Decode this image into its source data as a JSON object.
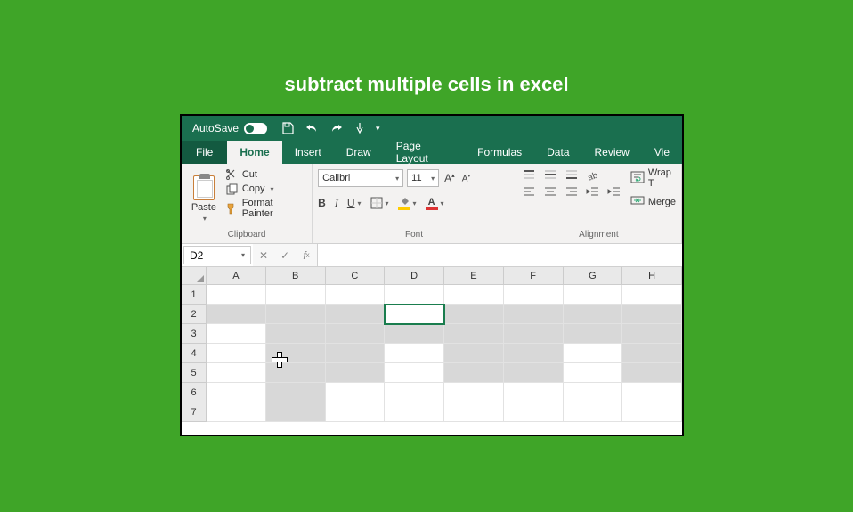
{
  "page_title": "subtract multiple cells in excel",
  "titlebar": {
    "autosave_label": "AutoSave",
    "autosave_state": "On"
  },
  "tabs": {
    "file": "File",
    "home": "Home",
    "insert": "Insert",
    "draw": "Draw",
    "page_layout": "Page Layout",
    "formulas": "Formulas",
    "data": "Data",
    "review": "Review",
    "view": "Vie"
  },
  "ribbon": {
    "clipboard": {
      "label": "Clipboard",
      "paste": "Paste",
      "cut": "Cut",
      "copy": "Copy",
      "format_painter": "Format Painter"
    },
    "font": {
      "label": "Font",
      "name": "Calibri",
      "size": "11"
    },
    "alignment": {
      "label": "Alignment",
      "wrap": "Wrap T",
      "merge": "Merge"
    }
  },
  "formula_bar": {
    "name_box": "D2",
    "formula": ""
  },
  "grid": {
    "columns": [
      "A",
      "B",
      "C",
      "D",
      "E",
      "F",
      "G",
      "H"
    ],
    "rows": [
      "1",
      "2",
      "3",
      "4",
      "5",
      "6",
      "7"
    ],
    "active_cell": "D2",
    "selected_cells": [
      "A2",
      "B2",
      "C2",
      "E2",
      "F2",
      "G2",
      "H2",
      "B3",
      "C3",
      "D3",
      "E3",
      "F3",
      "G3",
      "H3",
      "B4",
      "C4",
      "E4",
      "F4",
      "H4",
      "B5",
      "C5",
      "E5",
      "F5",
      "H5",
      "B6",
      "B7"
    ]
  }
}
